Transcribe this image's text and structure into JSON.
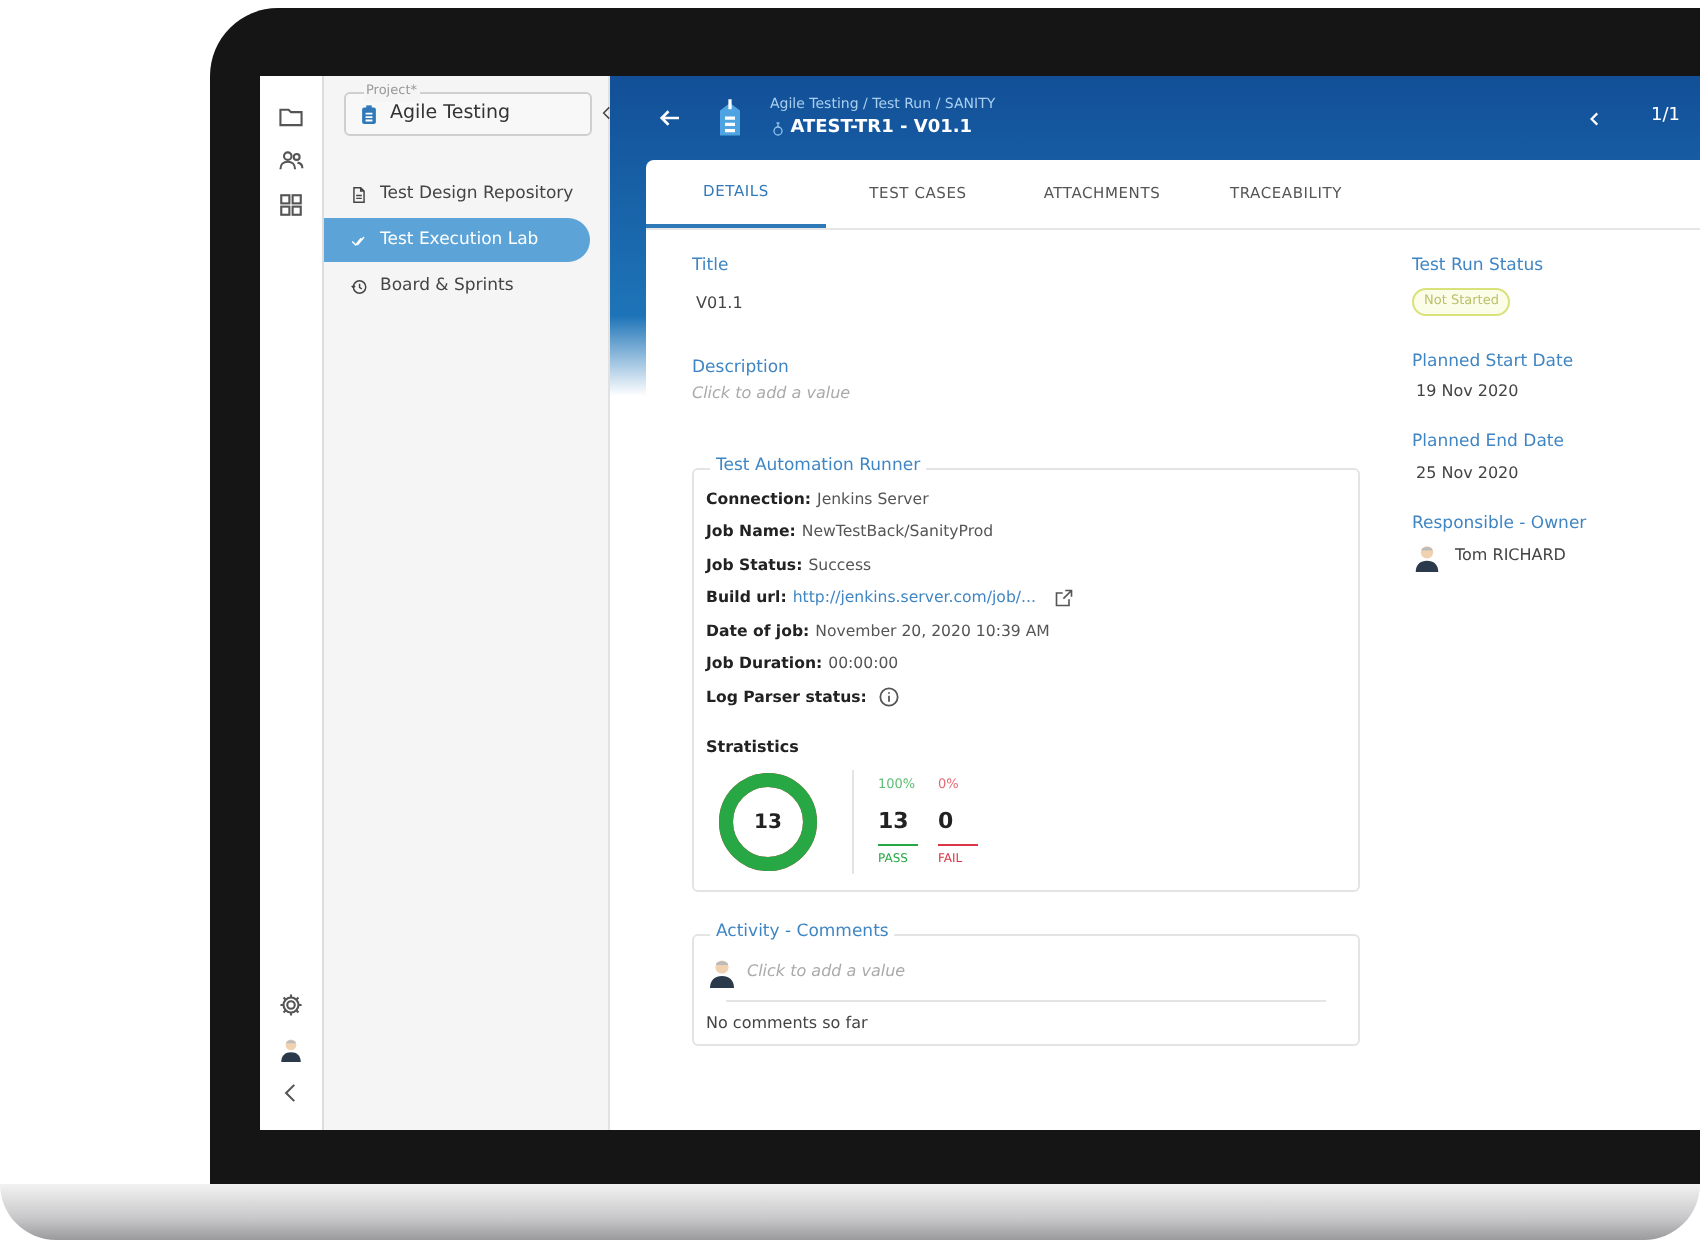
{
  "sidebar": {
    "project_label": "Project*",
    "project": "Agile Testing",
    "items": [
      {
        "label": "Test Design Repository",
        "kind": "document",
        "selected": false
      },
      {
        "label": "Test Execution Lab",
        "kind": "check",
        "selected": true
      },
      {
        "label": "Board & Sprints",
        "kind": "history",
        "selected": false
      }
    ]
  },
  "header": {
    "breadcrumb": [
      "Agile Testing",
      "Test Run",
      "SANITY"
    ],
    "separator": "/",
    "title": "ATEST-TR1 - V01.1",
    "pager": "1/1"
  },
  "tabs": [
    {
      "label": "DETAILS",
      "selected": true
    },
    {
      "label": "TEST CASES",
      "selected": false
    },
    {
      "label": "ATTACHMENTS",
      "selected": false
    },
    {
      "label": "TRACEABILITY",
      "selected": false
    }
  ],
  "title_field": {
    "label": "Title",
    "value": "V01.1"
  },
  "description_field": {
    "label": "Description",
    "placeholder": "Click to add a value"
  },
  "runner": {
    "title": "Test Automation Runner",
    "rows": [
      {
        "kind": "text",
        "label": "Connection:",
        "value": "Jenkins Server"
      },
      {
        "kind": "text",
        "label": "Job Name:",
        "value": "NewTestBack/SanityProd"
      },
      {
        "kind": "text",
        "label": "Job Status:",
        "value": "Success"
      },
      {
        "kind": "link",
        "label": "Build url:",
        "value": "http://jenkins.server.com/job/..."
      },
      {
        "kind": "text",
        "label": "Date of job:",
        "value": "November 20, 2020 10:39 AM"
      },
      {
        "kind": "text",
        "label": "Job Duration:",
        "value": "00:00:00"
      },
      {
        "kind": "info",
        "label": "Log Parser status:"
      }
    ],
    "statistics": {
      "title": "Stratistics",
      "total": "13",
      "level": 1,
      "results": [
        {
          "percent": "100%",
          "count": "13",
          "label": "PASS",
          "color": "#28a745"
        },
        {
          "percent": "0%",
          "count": "0",
          "label": "FAIL",
          "color": "#dc3545"
        }
      ]
    }
  },
  "comments": {
    "title": "Activity - Comments",
    "placeholder": "Click to add a value",
    "empty": "No comments so far"
  },
  "side_fields": {
    "status_label": "Test Run Status",
    "status": "Not Started",
    "start_label": "Planned Start Date",
    "start": "19 Nov 2020",
    "end_label": "Planned End Date",
    "end": "25 Nov 2020",
    "owner_label": "Responsible - Owner",
    "owner": "Tom RICHARD"
  }
}
